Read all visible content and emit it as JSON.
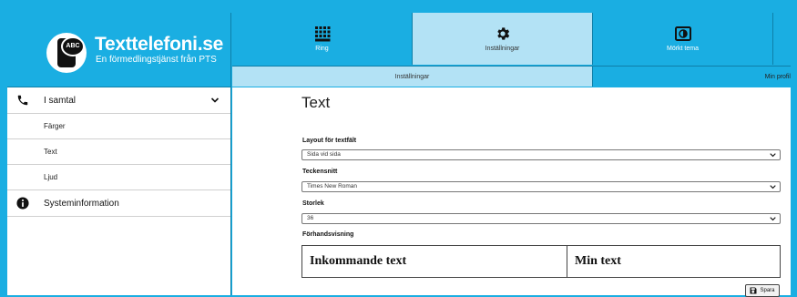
{
  "brand": {
    "title": "Texttelefoni.se",
    "subtitle": "En förmedlingstjänst från PTS",
    "logo_text": "ABC"
  },
  "topnav": [
    {
      "label": "Ring",
      "icon": "keypad-icon",
      "active": false
    },
    {
      "label": "Inställningar",
      "icon": "gear-icon",
      "active": true
    },
    {
      "label": "Mörkt tema",
      "icon": "contrast-icon",
      "active": false
    }
  ],
  "subnav": {
    "settings_label": "Inställningar",
    "profile_label": "Min profil"
  },
  "sidebar": {
    "call_section": {
      "label": "I samtal",
      "icon": "phone-icon",
      "expanded": true
    },
    "sub_items": [
      {
        "label": "Färger"
      },
      {
        "label": "Text"
      },
      {
        "label": "Ljud"
      }
    ],
    "sysinfo": {
      "label": "Systeminformation",
      "icon": "info-icon"
    }
  },
  "main": {
    "title": "Text",
    "layout": {
      "label": "Layout för textfält",
      "value": "Sida vid sida"
    },
    "font": {
      "label": "Teckensnitt",
      "value": "Times New Roman"
    },
    "size": {
      "label": "Storlek",
      "value": "36"
    },
    "preview": {
      "label": "Förhandsvisning",
      "incoming": "Inkommande text",
      "own": "Min text"
    },
    "save_label": "Spara"
  },
  "colors": {
    "brand_blue": "#1aaee2",
    "active_tab": "#b3e2f5"
  }
}
